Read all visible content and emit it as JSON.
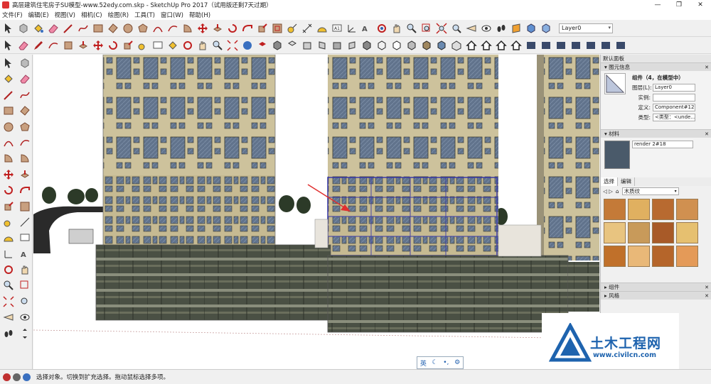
{
  "window": {
    "title": "高层建筑住宅房子SU模型-www.52edy.com.skp - SketchUp Pro 2017（试用版还剩7天过期）",
    "min": "—",
    "max": "❐",
    "close": "✕"
  },
  "menu": [
    "文件(F)",
    "编辑(E)",
    "视图(V)",
    "相机(C)",
    "绘图(R)",
    "工具(T)",
    "窗口(W)",
    "帮助(H)"
  ],
  "toolbar": {
    "layer_value": "Layer0"
  },
  "panel": {
    "tray_title": "默认面板",
    "entity_info": {
      "section": "图元信息",
      "heading": "组件（4，在模型中）",
      "layer_label": "图层(L):",
      "layer_value": "Layer0",
      "instance_label": "实例:",
      "instance_value": "",
      "definition_label": "定义:",
      "definition_value": "Component#12",
      "type_label": "类型:",
      "type_value": "<类型：<unde..."
    },
    "materials": {
      "section": "材料",
      "name_value": "render 2#18",
      "tab_select": "选择",
      "tab_edit": "编辑",
      "library_value": "木质纹"
    },
    "collapsed_sections": [
      "组件",
      "风格"
    ]
  },
  "statusbar": {
    "text": "选择对象。切换到扩充选择。拖动鼠标选择多项。"
  },
  "ime": {
    "lang": "英",
    "moon": "☾",
    "punct": "•,",
    "gear": "⚙"
  },
  "watermark": {
    "name": "土木工程网",
    "url": "www.civilcn.com"
  },
  "colors": {
    "selection": "#3a3aa8",
    "facade": "#c8bd95",
    "window": "#5a6f8a",
    "podium": "#3c4236",
    "arrow": "#e03030",
    "brand": "#1e63ae"
  }
}
